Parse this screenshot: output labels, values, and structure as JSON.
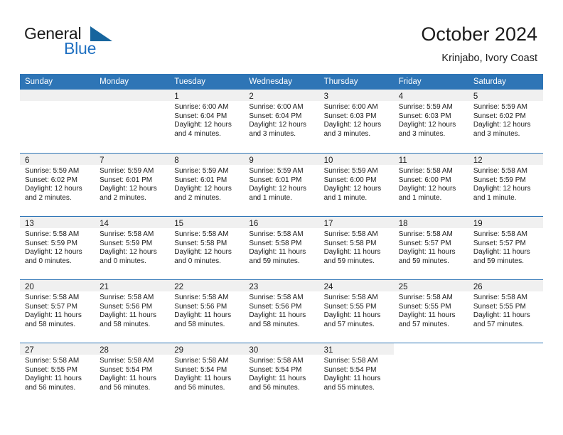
{
  "brand": {
    "name_top": "General",
    "name_bottom": "Blue",
    "triangle_color": "#16659e",
    "blue_color": "#1f70c1"
  },
  "header": {
    "title": "October 2024",
    "subtitle": "Krinjabo, Ivory Coast"
  },
  "colors": {
    "header_row_bg": "#2e75b6",
    "date_bar_bg": "#f0f0f0",
    "text": "#1b1b1b"
  },
  "weekdays": [
    "Sunday",
    "Monday",
    "Tuesday",
    "Wednesday",
    "Thursday",
    "Friday",
    "Saturday"
  ],
  "weeks": [
    [
      {
        "day": "",
        "blank": true
      },
      {
        "day": "",
        "blank": true
      },
      {
        "day": "1",
        "sunrise": "Sunrise: 6:00 AM",
        "sunset": "Sunset: 6:04 PM",
        "daylight1": "Daylight: 12 hours",
        "daylight2": "and 4 minutes."
      },
      {
        "day": "2",
        "sunrise": "Sunrise: 6:00 AM",
        "sunset": "Sunset: 6:04 PM",
        "daylight1": "Daylight: 12 hours",
        "daylight2": "and 3 minutes."
      },
      {
        "day": "3",
        "sunrise": "Sunrise: 6:00 AM",
        "sunset": "Sunset: 6:03 PM",
        "daylight1": "Daylight: 12 hours",
        "daylight2": "and 3 minutes."
      },
      {
        "day": "4",
        "sunrise": "Sunrise: 5:59 AM",
        "sunset": "Sunset: 6:03 PM",
        "daylight1": "Daylight: 12 hours",
        "daylight2": "and 3 minutes."
      },
      {
        "day": "5",
        "sunrise": "Sunrise: 5:59 AM",
        "sunset": "Sunset: 6:02 PM",
        "daylight1": "Daylight: 12 hours",
        "daylight2": "and 3 minutes."
      }
    ],
    [
      {
        "day": "6",
        "sunrise": "Sunrise: 5:59 AM",
        "sunset": "Sunset: 6:02 PM",
        "daylight1": "Daylight: 12 hours",
        "daylight2": "and 2 minutes."
      },
      {
        "day": "7",
        "sunrise": "Sunrise: 5:59 AM",
        "sunset": "Sunset: 6:01 PM",
        "daylight1": "Daylight: 12 hours",
        "daylight2": "and 2 minutes."
      },
      {
        "day": "8",
        "sunrise": "Sunrise: 5:59 AM",
        "sunset": "Sunset: 6:01 PM",
        "daylight1": "Daylight: 12 hours",
        "daylight2": "and 2 minutes."
      },
      {
        "day": "9",
        "sunrise": "Sunrise: 5:59 AM",
        "sunset": "Sunset: 6:01 PM",
        "daylight1": "Daylight: 12 hours",
        "daylight2": "and 1 minute."
      },
      {
        "day": "10",
        "sunrise": "Sunrise: 5:59 AM",
        "sunset": "Sunset: 6:00 PM",
        "daylight1": "Daylight: 12 hours",
        "daylight2": "and 1 minute."
      },
      {
        "day": "11",
        "sunrise": "Sunrise: 5:58 AM",
        "sunset": "Sunset: 6:00 PM",
        "daylight1": "Daylight: 12 hours",
        "daylight2": "and 1 minute."
      },
      {
        "day": "12",
        "sunrise": "Sunrise: 5:58 AM",
        "sunset": "Sunset: 5:59 PM",
        "daylight1": "Daylight: 12 hours",
        "daylight2": "and 1 minute."
      }
    ],
    [
      {
        "day": "13",
        "sunrise": "Sunrise: 5:58 AM",
        "sunset": "Sunset: 5:59 PM",
        "daylight1": "Daylight: 12 hours",
        "daylight2": "and 0 minutes."
      },
      {
        "day": "14",
        "sunrise": "Sunrise: 5:58 AM",
        "sunset": "Sunset: 5:59 PM",
        "daylight1": "Daylight: 12 hours",
        "daylight2": "and 0 minutes."
      },
      {
        "day": "15",
        "sunrise": "Sunrise: 5:58 AM",
        "sunset": "Sunset: 5:58 PM",
        "daylight1": "Daylight: 12 hours",
        "daylight2": "and 0 minutes."
      },
      {
        "day": "16",
        "sunrise": "Sunrise: 5:58 AM",
        "sunset": "Sunset: 5:58 PM",
        "daylight1": "Daylight: 11 hours",
        "daylight2": "and 59 minutes."
      },
      {
        "day": "17",
        "sunrise": "Sunrise: 5:58 AM",
        "sunset": "Sunset: 5:58 PM",
        "daylight1": "Daylight: 11 hours",
        "daylight2": "and 59 minutes."
      },
      {
        "day": "18",
        "sunrise": "Sunrise: 5:58 AM",
        "sunset": "Sunset: 5:57 PM",
        "daylight1": "Daylight: 11 hours",
        "daylight2": "and 59 minutes."
      },
      {
        "day": "19",
        "sunrise": "Sunrise: 5:58 AM",
        "sunset": "Sunset: 5:57 PM",
        "daylight1": "Daylight: 11 hours",
        "daylight2": "and 59 minutes."
      }
    ],
    [
      {
        "day": "20",
        "sunrise": "Sunrise: 5:58 AM",
        "sunset": "Sunset: 5:57 PM",
        "daylight1": "Daylight: 11 hours",
        "daylight2": "and 58 minutes."
      },
      {
        "day": "21",
        "sunrise": "Sunrise: 5:58 AM",
        "sunset": "Sunset: 5:56 PM",
        "daylight1": "Daylight: 11 hours",
        "daylight2": "and 58 minutes."
      },
      {
        "day": "22",
        "sunrise": "Sunrise: 5:58 AM",
        "sunset": "Sunset: 5:56 PM",
        "daylight1": "Daylight: 11 hours",
        "daylight2": "and 58 minutes."
      },
      {
        "day": "23",
        "sunrise": "Sunrise: 5:58 AM",
        "sunset": "Sunset: 5:56 PM",
        "daylight1": "Daylight: 11 hours",
        "daylight2": "and 58 minutes."
      },
      {
        "day": "24",
        "sunrise": "Sunrise: 5:58 AM",
        "sunset": "Sunset: 5:55 PM",
        "daylight1": "Daylight: 11 hours",
        "daylight2": "and 57 minutes."
      },
      {
        "day": "25",
        "sunrise": "Sunrise: 5:58 AM",
        "sunset": "Sunset: 5:55 PM",
        "daylight1": "Daylight: 11 hours",
        "daylight2": "and 57 minutes."
      },
      {
        "day": "26",
        "sunrise": "Sunrise: 5:58 AM",
        "sunset": "Sunset: 5:55 PM",
        "daylight1": "Daylight: 11 hours",
        "daylight2": "and 57 minutes."
      }
    ],
    [
      {
        "day": "27",
        "sunrise": "Sunrise: 5:58 AM",
        "sunset": "Sunset: 5:55 PM",
        "daylight1": "Daylight: 11 hours",
        "daylight2": "and 56 minutes."
      },
      {
        "day": "28",
        "sunrise": "Sunrise: 5:58 AM",
        "sunset": "Sunset: 5:54 PM",
        "daylight1": "Daylight: 11 hours",
        "daylight2": "and 56 minutes."
      },
      {
        "day": "29",
        "sunrise": "Sunrise: 5:58 AM",
        "sunset": "Sunset: 5:54 PM",
        "daylight1": "Daylight: 11 hours",
        "daylight2": "and 56 minutes."
      },
      {
        "day": "30",
        "sunrise": "Sunrise: 5:58 AM",
        "sunset": "Sunset: 5:54 PM",
        "daylight1": "Daylight: 11 hours",
        "daylight2": "and 56 minutes."
      },
      {
        "day": "31",
        "sunrise": "Sunrise: 5:58 AM",
        "sunset": "Sunset: 5:54 PM",
        "daylight1": "Daylight: 11 hours",
        "daylight2": "and 55 minutes."
      },
      {
        "day": "",
        "empty_tail": true
      },
      {
        "day": "",
        "empty_tail": true
      }
    ]
  ]
}
